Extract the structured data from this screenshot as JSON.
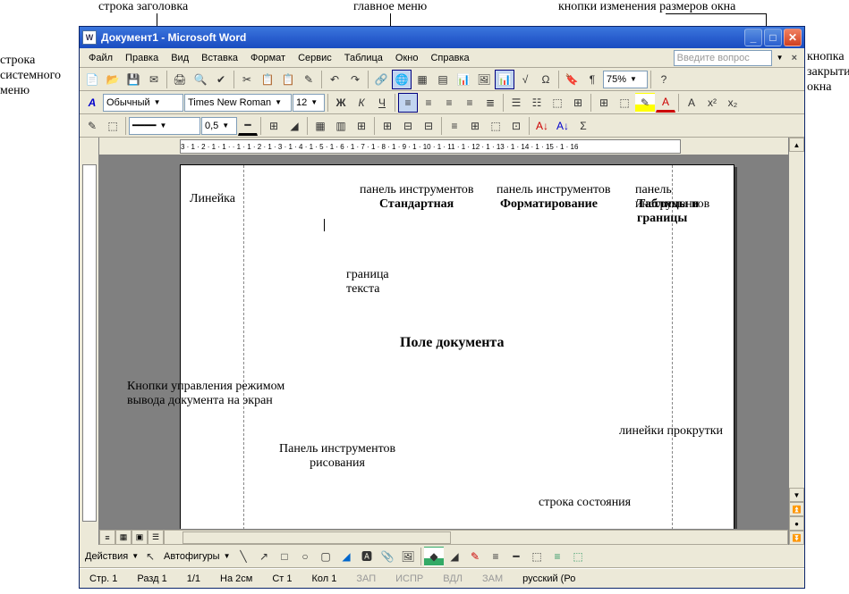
{
  "outer_labels": {
    "title_row": "строка заголовка",
    "main_menu": "главное меню",
    "window_size_btns": "кнопки изменения размеров окна",
    "system_menu_row": "строка\nсистемного\nменю",
    "close_btn": "кнопка\nзакрытия\nокна",
    "ruler": "Линейка",
    "toolbar_standard_1": "панель инструментов",
    "toolbar_standard_2": "Стандартная",
    "toolbar_format_1": "панель инструментов",
    "toolbar_format_2": "Форматирование",
    "toolbar_tables_1": "панель инструментов",
    "toolbar_tables_2": "Таблицы и границы",
    "text_border": "граница\nтекста",
    "doc_field": "Поле документа",
    "view_btns": "Кнопки управления режимом\nвывода документа на экран",
    "drawing_toolbar": "Панель инструментов\nрисования",
    "scrollbars": "линейки прокрутки",
    "status_row": "строка состояния"
  },
  "titlebar": {
    "title": "Документ1 - Microsoft Word",
    "sys_icon": "W"
  },
  "menu": [
    "Файл",
    "Правка",
    "Вид",
    "Вставка",
    "Формат",
    "Сервис",
    "Таблица",
    "Окно",
    "Справка"
  ],
  "ask_box": "Введите вопрос",
  "toolbar_std_icons": [
    "📄",
    "📂",
    "💾",
    "✉",
    "🖨",
    "🔍",
    "✔",
    "✂",
    "📋",
    "📋",
    "✎",
    "↶",
    "↷",
    "🔗",
    "🌐",
    "▦",
    "▤",
    "📊",
    "🖼",
    "📊",
    "√",
    "Ω",
    "🔖",
    "¶"
  ],
  "zoom": "75%",
  "fmt": {
    "style_icon": "A",
    "style": "Обычный",
    "font": "Times New Roman",
    "size": "12"
  },
  "fmt_icons": [
    "Ж",
    "К",
    "Ч",
    "≡",
    "≡",
    "≡",
    "≡",
    "≣",
    "☰",
    "☷",
    "⬚",
    "⊞",
    "⊞",
    "⬚",
    "✎",
    "A",
    "A",
    "x²",
    "x₂"
  ],
  "tables": {
    "width": "0,5"
  },
  "tables_icons": [
    "✎",
    "⬚",
    "⊞",
    "━",
    "◢",
    "⬛",
    "▦",
    "▥",
    "⊞",
    "⊞",
    "⊟",
    "⊟",
    "≡",
    "⊞",
    "⬚",
    "⊡",
    "A↓",
    "A↓",
    "Σ"
  ],
  "ruler_text": "3 · 1 · 2 · 1 · 1 ·     · 1 · 1 · 2 · 1 · 3 · 1 · 4 · 1 · 5 · 1 · 6 · 1 · 7 · 1 · 8 · 1 · 9 · 1 · 10 · 1 · 11 · 1 · 12 · 1 · 13 · 1 · 14 · 1 · 15 · 1 · 16",
  "drawing": {
    "actions": "Действия",
    "autoshapes": "Автофигуры"
  },
  "drawing_icons": [
    "↖",
    "╲",
    "↗",
    "□",
    "○",
    "▢",
    "◢",
    "🅰",
    "📎",
    "🖼",
    "◆",
    "◢",
    "✎",
    "A",
    "≡",
    "━",
    "⬚",
    "≡",
    "⬚"
  ],
  "status": {
    "page": "Стр. 1",
    "section": "Разд 1",
    "pages": "1/1",
    "at": "На 2см",
    "line": "Ст 1",
    "col": "Кол 1",
    "rec": "ЗАП",
    "trk": "ИСПР",
    "ext": "ВДЛ",
    "ovr": "ЗАМ",
    "lang": "русский (Ро"
  }
}
